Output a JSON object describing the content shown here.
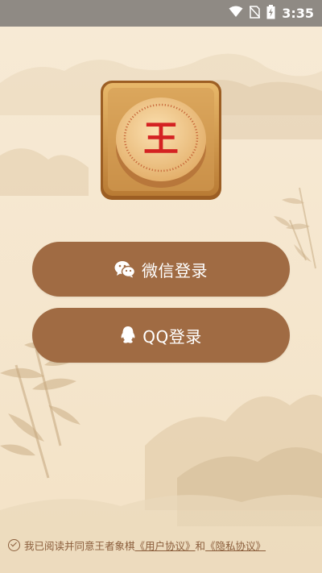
{
  "status_bar": {
    "time": "3:35",
    "icons": [
      "wifi-icon",
      "no-sim-icon",
      "battery-charging-icon"
    ]
  },
  "logo": {
    "character": "王",
    "icon": "chinese-chess-piece-icon"
  },
  "buttons": {
    "wechat": {
      "label": "微信登录",
      "icon": "wechat-icon"
    },
    "qq": {
      "label": "QQ登录",
      "icon": "qq-penguin-icon"
    }
  },
  "agreement": {
    "prefix": "我已阅读并同意王者象棋",
    "user_agreement": "《用户协议》",
    "conjunction": "和",
    "privacy_policy": "《隐私协议》"
  },
  "colors": {
    "button": "#a06b43",
    "background": "#f6e7cf",
    "text_accent": "#8b5e3c",
    "status_bar": "#8f8a84"
  }
}
